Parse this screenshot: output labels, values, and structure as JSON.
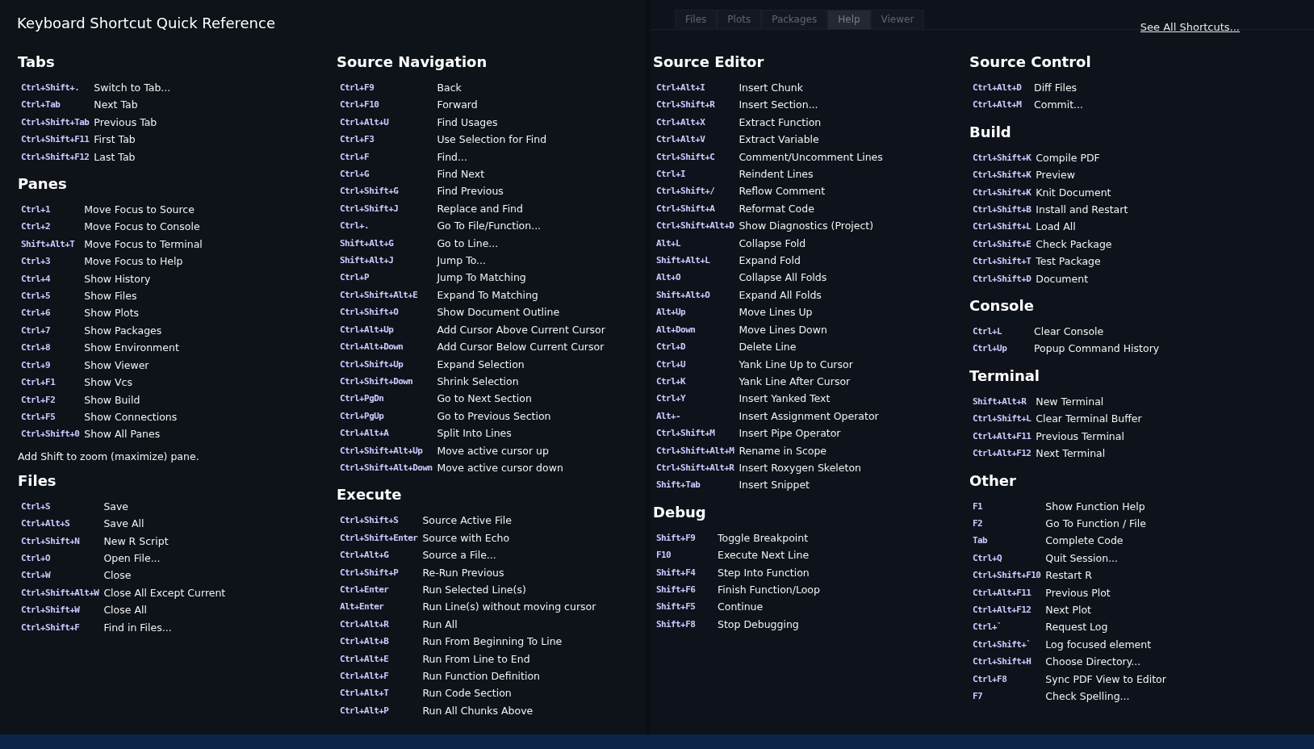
{
  "pane_tabs": [
    {
      "label": "Files",
      "selected": false
    },
    {
      "label": "Plots",
      "selected": false
    },
    {
      "label": "Packages",
      "selected": false
    },
    {
      "label": "Help",
      "selected": true
    },
    {
      "label": "Viewer",
      "selected": false
    }
  ],
  "title": "Keyboard Shortcut Quick Reference",
  "link": "See All Shortcuts...",
  "columns": [
    {
      "sections": [
        {
          "title": "Tabs",
          "rows": [
            {
              "keys": "Ctrl+Shift+.",
              "action": "Switch to Tab..."
            },
            {
              "keys": "Ctrl+Tab",
              "action": "Next Tab"
            },
            {
              "keys": "Ctrl+Shift+Tab",
              "action": "Previous Tab"
            },
            {
              "keys": "Ctrl+Shift+F11",
              "action": "First Tab"
            },
            {
              "keys": "Ctrl+Shift+F12",
              "action": "Last Tab"
            }
          ]
        },
        {
          "title": "Panes",
          "rows": [
            {
              "keys": "Ctrl+1",
              "action": "Move Focus to Source"
            },
            {
              "keys": "Ctrl+2",
              "action": "Move Focus to Console"
            },
            {
              "keys": "Shift+Alt+T",
              "action": "Move Focus to Terminal"
            },
            {
              "keys": "Ctrl+3",
              "action": "Move Focus to Help"
            },
            {
              "keys": "Ctrl+4",
              "action": "Show History"
            },
            {
              "keys": "Ctrl+5",
              "action": "Show Files"
            },
            {
              "keys": "Ctrl+6",
              "action": "Show Plots"
            },
            {
              "keys": "Ctrl+7",
              "action": "Show Packages"
            },
            {
              "keys": "Ctrl+8",
              "action": "Show Environment"
            },
            {
              "keys": "Ctrl+9",
              "action": "Show Viewer"
            },
            {
              "keys": "Ctrl+F1",
              "action": "Show Vcs"
            },
            {
              "keys": "Ctrl+F2",
              "action": "Show Build"
            },
            {
              "keys": "Ctrl+F5",
              "action": "Show Connections"
            },
            {
              "keys": "Ctrl+Shift+0",
              "action": "Show All Panes"
            }
          ],
          "note": "Add Shift to zoom (maximize) pane."
        },
        {
          "title": "Files",
          "rows": [
            {
              "keys": "Ctrl+S",
              "action": "Save"
            },
            {
              "keys": "Ctrl+Alt+S",
              "action": "Save All"
            },
            {
              "keys": "Ctrl+Shift+N",
              "action": "New R Script"
            },
            {
              "keys": "Ctrl+O",
              "action": "Open File..."
            },
            {
              "keys": "Ctrl+W",
              "action": "Close"
            },
            {
              "keys": "Ctrl+Shift+Alt+W",
              "action": "Close All Except Current"
            },
            {
              "keys": "Ctrl+Shift+W",
              "action": "Close All"
            },
            {
              "keys": "Ctrl+Shift+F",
              "action": "Find in Files..."
            }
          ]
        }
      ]
    },
    {
      "sections": [
        {
          "title": "Source Navigation",
          "rows": [
            {
              "keys": "Ctrl+F9",
              "action": "Back"
            },
            {
              "keys": "Ctrl+F10",
              "action": "Forward"
            },
            {
              "keys": "Ctrl+Alt+U",
              "action": "Find Usages"
            },
            {
              "keys": "Ctrl+F3",
              "action": "Use Selection for Find"
            },
            {
              "keys": "Ctrl+F",
              "action": "Find..."
            },
            {
              "keys": "Ctrl+G",
              "action": "Find Next"
            },
            {
              "keys": "Ctrl+Shift+G",
              "action": "Find Previous"
            },
            {
              "keys": "Ctrl+Shift+J",
              "action": "Replace and Find"
            },
            {
              "keys": "Ctrl+.",
              "action": "Go To File/Function..."
            },
            {
              "keys": "Shift+Alt+G",
              "action": "Go to Line..."
            },
            {
              "keys": "Shift+Alt+J",
              "action": "Jump To..."
            },
            {
              "keys": "Ctrl+P",
              "action": "Jump To Matching"
            },
            {
              "keys": "Ctrl+Shift+Alt+E",
              "action": "Expand To Matching"
            },
            {
              "keys": "Ctrl+Shift+O",
              "action": "Show Document Outline"
            },
            {
              "keys": "Ctrl+Alt+Up",
              "action": "Add Cursor Above Current Cursor"
            },
            {
              "keys": "Ctrl+Alt+Down",
              "action": "Add Cursor Below Current Cursor"
            },
            {
              "keys": "Ctrl+Shift+Up",
              "action": "Expand Selection"
            },
            {
              "keys": "Ctrl+Shift+Down",
              "action": "Shrink Selection"
            },
            {
              "keys": "Ctrl+PgDn",
              "action": "Go to Next Section"
            },
            {
              "keys": "Ctrl+PgUp",
              "action": "Go to Previous Section"
            },
            {
              "keys": "Ctrl+Alt+A",
              "action": "Split Into Lines"
            },
            {
              "keys": "Ctrl+Shift+Alt+Up",
              "action": "Move active cursor up"
            },
            {
              "keys": "Ctrl+Shift+Alt+Down",
              "action": "Move active cursor down"
            }
          ]
        },
        {
          "title": "Execute",
          "rows": [
            {
              "keys": "Ctrl+Shift+S",
              "action": "Source Active File"
            },
            {
              "keys": "Ctrl+Shift+Enter",
              "action": "Source with Echo"
            },
            {
              "keys": "Ctrl+Alt+G",
              "action": "Source a File..."
            },
            {
              "keys": "Ctrl+Shift+P",
              "action": "Re-Run Previous"
            },
            {
              "keys": "Ctrl+Enter",
              "action": "Run Selected Line(s)"
            },
            {
              "keys": "Alt+Enter",
              "action": "Run Line(s) without moving cursor"
            },
            {
              "keys": "Ctrl+Alt+R",
              "action": "Run All"
            },
            {
              "keys": "Ctrl+Alt+B",
              "action": "Run From Beginning To Line"
            },
            {
              "keys": "Ctrl+Alt+E",
              "action": "Run From Line to End"
            },
            {
              "keys": "Ctrl+Alt+F",
              "action": "Run Function Definition"
            },
            {
              "keys": "Ctrl+Alt+T",
              "action": "Run Code Section"
            },
            {
              "keys": "Ctrl+Alt+P",
              "action": "Run All Chunks Above"
            }
          ]
        }
      ]
    },
    {
      "sections": [
        {
          "title": "Source Editor",
          "rows": [
            {
              "keys": "Ctrl+Alt+I",
              "action": "Insert Chunk"
            },
            {
              "keys": "Ctrl+Shift+R",
              "action": "Insert Section..."
            },
            {
              "keys": "Ctrl+Alt+X",
              "action": "Extract Function"
            },
            {
              "keys": "Ctrl+Alt+V",
              "action": "Extract Variable"
            },
            {
              "keys": "Ctrl+Shift+C",
              "action": "Comment/Uncomment Lines"
            },
            {
              "keys": "Ctrl+I",
              "action": "Reindent Lines"
            },
            {
              "keys": "Ctrl+Shift+/",
              "action": "Reflow Comment"
            },
            {
              "keys": "Ctrl+Shift+A",
              "action": "Reformat Code"
            },
            {
              "keys": "Ctrl+Shift+Alt+D",
              "action": "Show Diagnostics (Project)"
            },
            {
              "keys": "Alt+L",
              "action": "Collapse Fold"
            },
            {
              "keys": "Shift+Alt+L",
              "action": "Expand Fold"
            },
            {
              "keys": "Alt+O",
              "action": "Collapse All Folds"
            },
            {
              "keys": "Shift+Alt+O",
              "action": "Expand All Folds"
            },
            {
              "keys": "Alt+Up",
              "action": "Move Lines Up"
            },
            {
              "keys": "Alt+Down",
              "action": "Move Lines Down"
            },
            {
              "keys": "Ctrl+D",
              "action": "Delete Line"
            },
            {
              "keys": "Ctrl+U",
              "action": "Yank Line Up to Cursor"
            },
            {
              "keys": "Ctrl+K",
              "action": "Yank Line After Cursor"
            },
            {
              "keys": "Ctrl+Y",
              "action": "Insert Yanked Text"
            },
            {
              "keys": "Alt+-",
              "action": "Insert Assignment Operator"
            },
            {
              "keys": "Ctrl+Shift+M",
              "action": "Insert Pipe Operator"
            },
            {
              "keys": "Ctrl+Shift+Alt+M",
              "action": "Rename in Scope"
            },
            {
              "keys": "Ctrl+Shift+Alt+R",
              "action": "Insert Roxygen Skeleton"
            },
            {
              "keys": "Shift+Tab",
              "action": "Insert Snippet"
            }
          ]
        },
        {
          "title": "Debug",
          "rows": [
            {
              "keys": "Shift+F9",
              "action": "Toggle Breakpoint"
            },
            {
              "keys": "F10",
              "action": "Execute Next Line"
            },
            {
              "keys": "Shift+F4",
              "action": "Step Into Function"
            },
            {
              "keys": "Shift+F6",
              "action": "Finish Function/Loop"
            },
            {
              "keys": "Shift+F5",
              "action": "Continue"
            },
            {
              "keys": "Shift+F8",
              "action": "Stop Debugging"
            }
          ]
        }
      ]
    },
    {
      "sections": [
        {
          "title": "Source Control",
          "rows": [
            {
              "keys": "Ctrl+Alt+D",
              "action": "Diff Files"
            },
            {
              "keys": "Ctrl+Alt+M",
              "action": "Commit..."
            }
          ]
        },
        {
          "title": "Build",
          "rows": [
            {
              "keys": "Ctrl+Shift+K",
              "action": "Compile PDF"
            },
            {
              "keys": "Ctrl+Shift+K",
              "action": "Preview"
            },
            {
              "keys": "Ctrl+Shift+K",
              "action": "Knit Document"
            },
            {
              "keys": "Ctrl+Shift+B",
              "action": "Install and Restart"
            },
            {
              "keys": "Ctrl+Shift+L",
              "action": "Load All"
            },
            {
              "keys": "Ctrl+Shift+E",
              "action": "Check Package"
            },
            {
              "keys": "Ctrl+Shift+T",
              "action": "Test Package"
            },
            {
              "keys": "Ctrl+Shift+D",
              "action": "Document"
            }
          ]
        },
        {
          "title": "Console",
          "rows": [
            {
              "keys": "Ctrl+L",
              "action": "Clear Console"
            },
            {
              "keys": "Ctrl+Up",
              "action": "Popup Command History"
            }
          ]
        },
        {
          "title": "Terminal",
          "rows": [
            {
              "keys": "Shift+Alt+R",
              "action": "New Terminal"
            },
            {
              "keys": "Ctrl+Shift+L",
              "action": "Clear Terminal Buffer"
            },
            {
              "keys": "Ctrl+Alt+F11",
              "action": "Previous Terminal"
            },
            {
              "keys": "Ctrl+Alt+F12",
              "action": "Next Terminal"
            }
          ]
        },
        {
          "title": "Other",
          "rows": [
            {
              "keys": "F1",
              "action": "Show Function Help"
            },
            {
              "keys": "F2",
              "action": "Go To Function / File"
            },
            {
              "keys": "Tab",
              "action": "Complete Code"
            },
            {
              "keys": "Ctrl+Q",
              "action": "Quit Session..."
            },
            {
              "keys": "Ctrl+Shift+F10",
              "action": "Restart R"
            },
            {
              "keys": "Ctrl+Alt+F11",
              "action": "Previous Plot"
            },
            {
              "keys": "Ctrl+Alt+F12",
              "action": "Next Plot"
            },
            {
              "keys": "Ctrl+`",
              "action": "Request Log"
            },
            {
              "keys": "Ctrl+Shift+`",
              "action": "Log focused element"
            },
            {
              "keys": "Ctrl+Shift+H",
              "action": "Choose Directory..."
            },
            {
              "keys": "Ctrl+F8",
              "action": "Sync PDF View to Editor"
            },
            {
              "keys": "F7",
              "action": "Check Spelling..."
            }
          ]
        }
      ]
    }
  ]
}
